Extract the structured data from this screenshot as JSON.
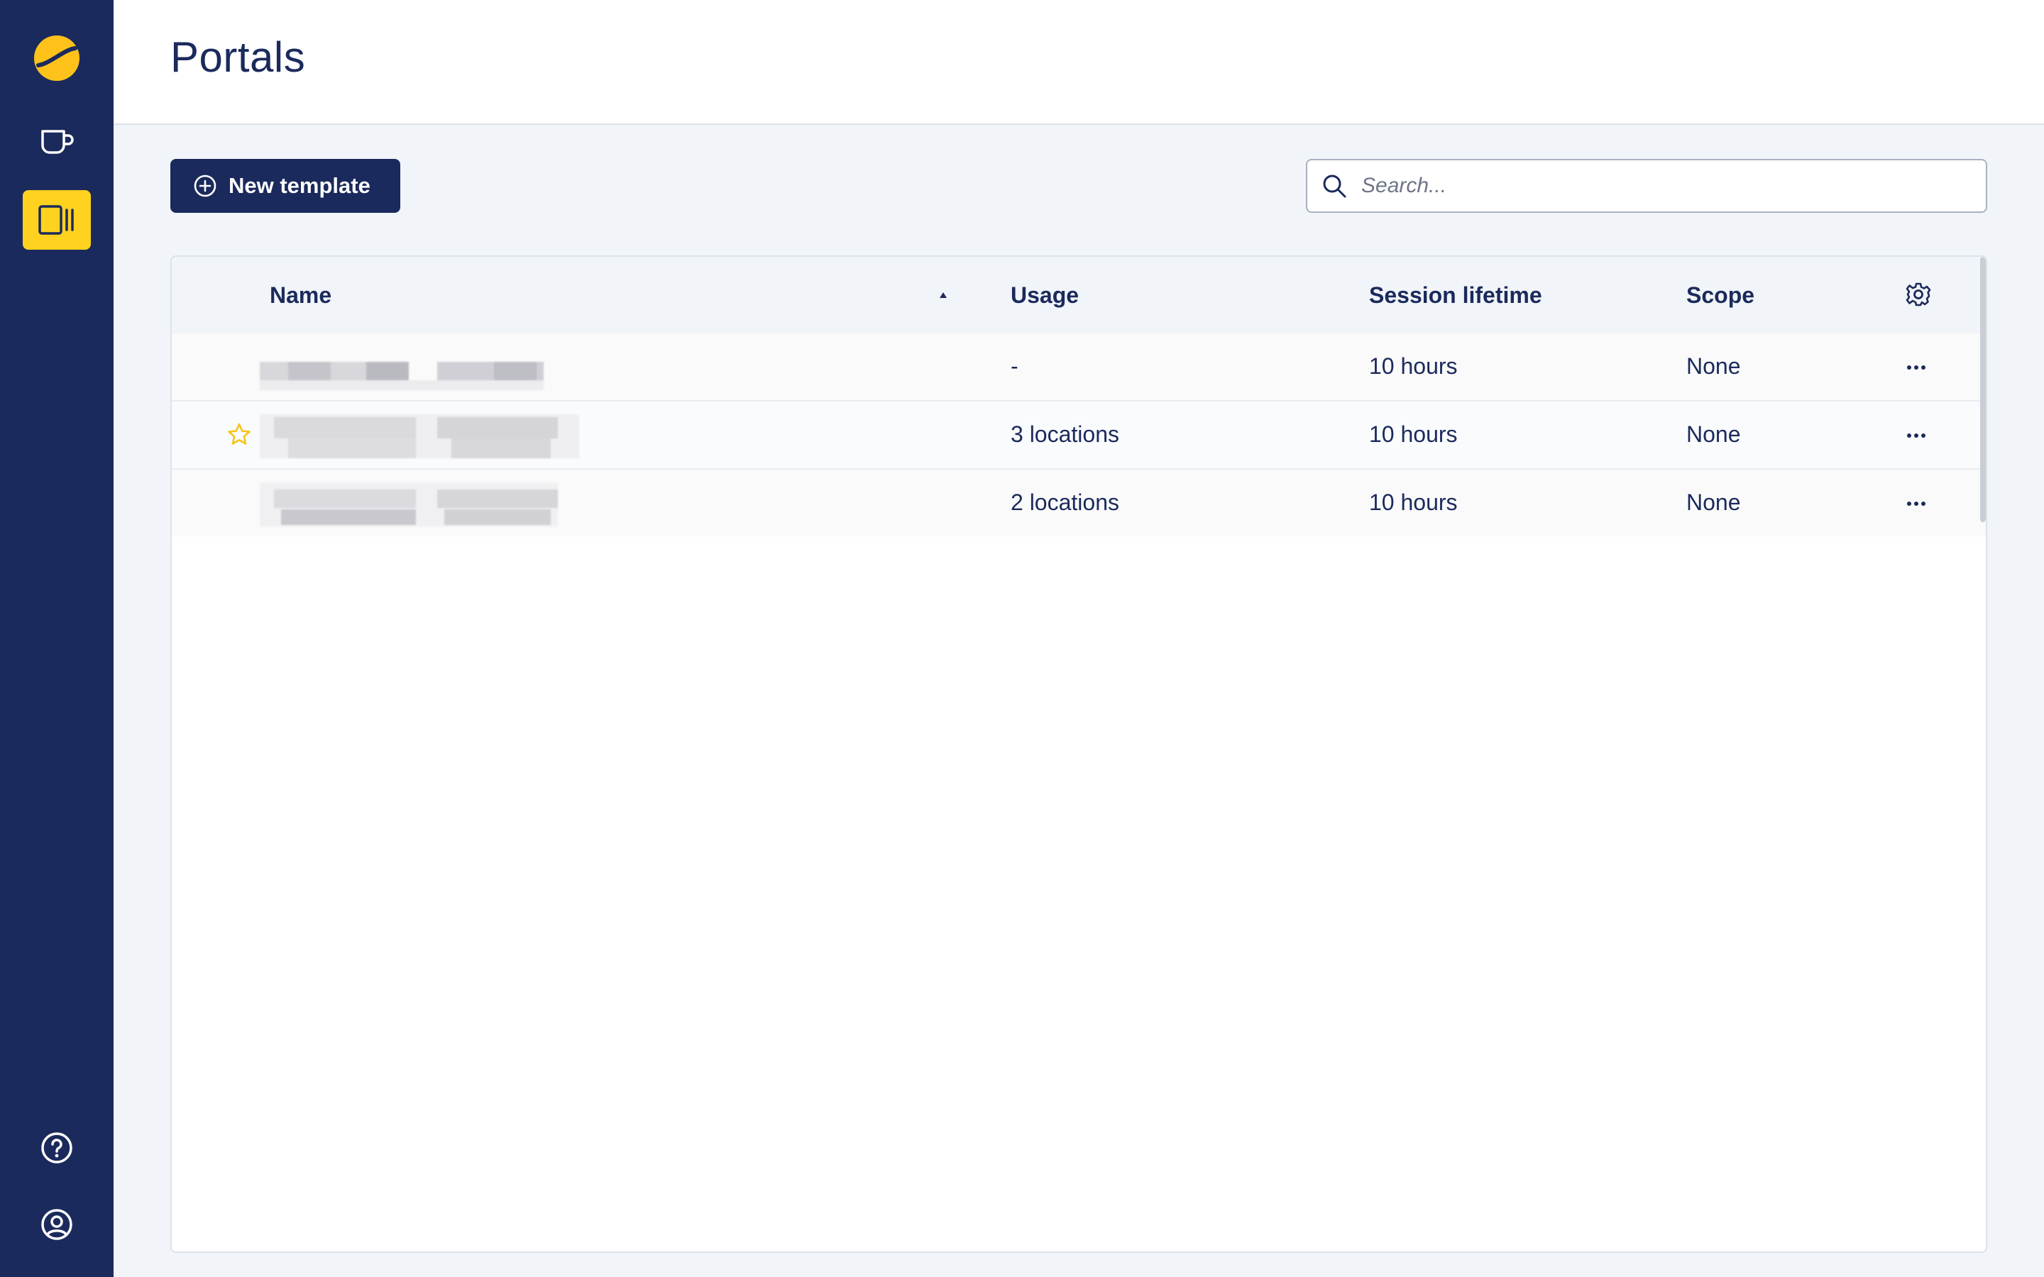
{
  "page": {
    "title": "Portals"
  },
  "sidebar": {
    "logo": "brand-logo",
    "items": [
      {
        "name": "cup",
        "icon": "cup-icon"
      },
      {
        "name": "portals",
        "icon": "portal-icon",
        "active": true
      }
    ],
    "bottom": [
      {
        "name": "help",
        "icon": "help-icon"
      },
      {
        "name": "account",
        "icon": "user-circle-icon"
      }
    ]
  },
  "toolbar": {
    "new_template_label": "New template",
    "search_placeholder": "Search..."
  },
  "table": {
    "columns": {
      "name": "Name",
      "usage": "Usage",
      "session_lifetime": "Session lifetime",
      "scope": "Scope"
    },
    "rows": [
      {
        "usage": "-",
        "session_lifetime": "10 hours",
        "scope": "None",
        "starred": false
      },
      {
        "usage": "3 locations",
        "session_lifetime": "10 hours",
        "scope": "None",
        "starred": true
      },
      {
        "usage": "2 locations",
        "session_lifetime": "10 hours",
        "scope": "None",
        "starred": false
      }
    ]
  },
  "colors": {
    "navy": "#1b2a5c",
    "accent_yellow": "#ffd21f",
    "background": "#f1f4f8"
  }
}
